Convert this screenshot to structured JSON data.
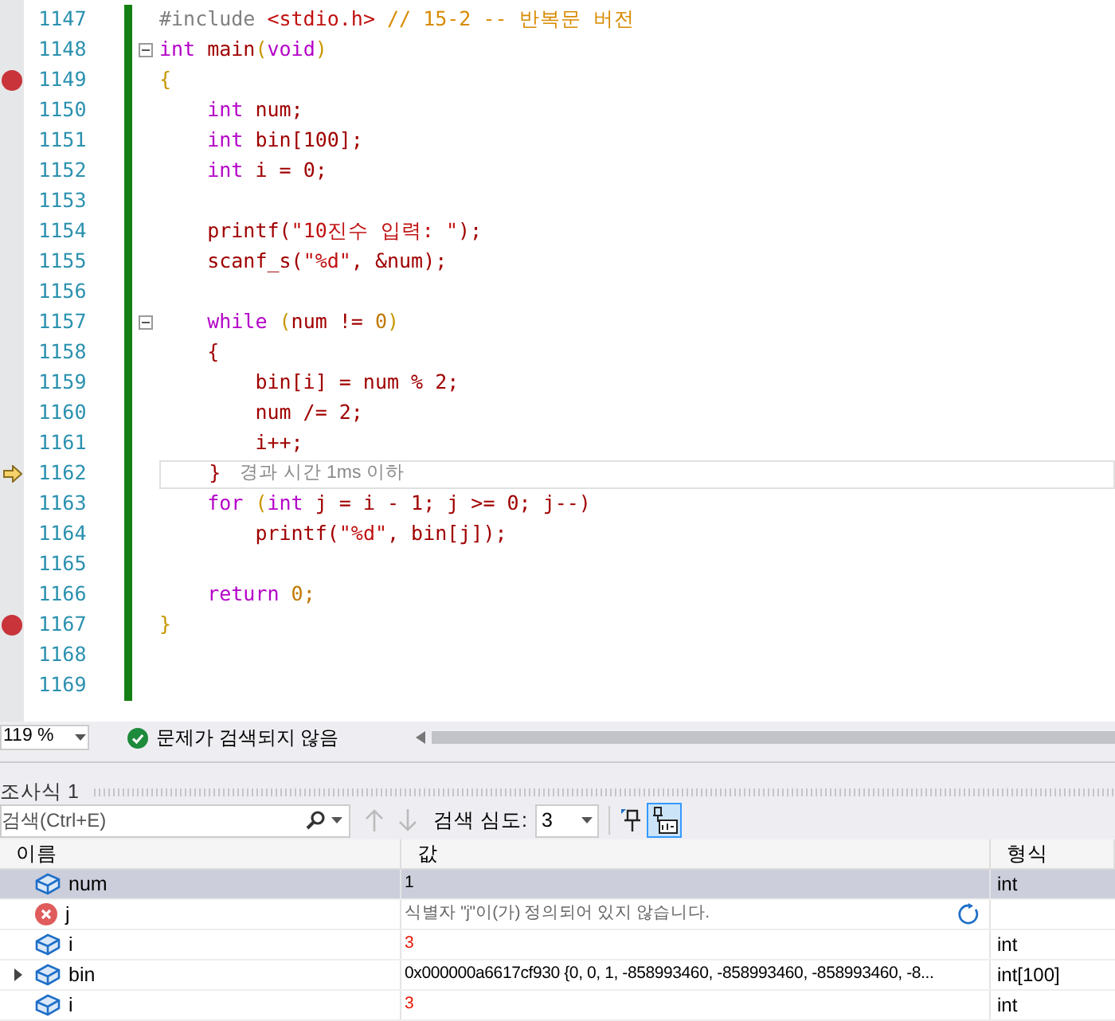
{
  "editor": {
    "lines": [
      {
        "number": "1147",
        "breakpoint": false,
        "current": false,
        "tokens": [
          {
            "kind": "pre",
            "text": "#include "
          },
          {
            "kind": "string",
            "text": "<stdio.h>"
          },
          {
            "kind": "comment",
            "text": " // 15-2 -- 반복문 버전"
          }
        ]
      },
      {
        "number": "1148",
        "breakpoint": false,
        "current": false,
        "fold": true,
        "tokens": [
          {
            "kind": "keyword",
            "text": "int"
          },
          {
            "kind": "ident",
            "text": " main"
          },
          {
            "kind": "punct",
            "text": "("
          },
          {
            "kind": "keyword",
            "text": "void"
          },
          {
            "kind": "punct",
            "text": ")"
          }
        ]
      },
      {
        "number": "1149",
        "breakpoint": true,
        "current": false,
        "tokens": [
          {
            "kind": "punct",
            "text": "{"
          }
        ]
      },
      {
        "number": "1150",
        "breakpoint": false,
        "current": false,
        "tokens": [
          {
            "kind": "keyword",
            "text": "    int"
          },
          {
            "kind": "ident",
            "text": " num;"
          }
        ]
      },
      {
        "number": "1151",
        "breakpoint": false,
        "current": false,
        "tokens": [
          {
            "kind": "keyword",
            "text": "    int"
          },
          {
            "kind": "ident",
            "text": " bin[100];"
          }
        ]
      },
      {
        "number": "1152",
        "breakpoint": false,
        "current": false,
        "tokens": [
          {
            "kind": "keyword",
            "text": "    int"
          },
          {
            "kind": "ident",
            "text": " i = 0;"
          }
        ]
      },
      {
        "number": "1153",
        "breakpoint": false,
        "current": false
      },
      {
        "number": "1154",
        "breakpoint": false,
        "current": false,
        "tokens": [
          {
            "kind": "ident",
            "text": "    printf("
          },
          {
            "kind": "string",
            "text": "\"10진수 입력: \""
          },
          {
            "kind": "ident",
            "text": ");"
          }
        ]
      },
      {
        "number": "1155",
        "breakpoint": false,
        "current": false,
        "tokens": [
          {
            "kind": "ident",
            "text": "    scanf_s("
          },
          {
            "kind": "string",
            "text": "\"%d\""
          },
          {
            "kind": "ident",
            "text": ", &num);"
          }
        ]
      },
      {
        "number": "1156",
        "breakpoint": false,
        "current": false
      },
      {
        "number": "1157",
        "breakpoint": false,
        "current": false,
        "fold": true,
        "tokens": [
          {
            "kind": "keyword",
            "text": "    while"
          },
          {
            "kind": "punct",
            "text": " ("
          },
          {
            "kind": "ident",
            "text": "num != "
          },
          {
            "kind": "number",
            "text": "0"
          },
          {
            "kind": "punct",
            "text": ")"
          }
        ]
      },
      {
        "number": "1158",
        "breakpoint": false,
        "current": false,
        "tokens": [
          {
            "kind": "ident",
            "text": "    {"
          }
        ]
      },
      {
        "number": "1159",
        "breakpoint": false,
        "current": false,
        "tokens": [
          {
            "kind": "ident",
            "text": "        bin[i] = num % 2;"
          }
        ]
      },
      {
        "number": "1160",
        "breakpoint": false,
        "current": false,
        "tokens": [
          {
            "kind": "ident",
            "text": "        num /= 2;"
          }
        ]
      },
      {
        "number": "1161",
        "breakpoint": false,
        "current": false,
        "tokens": [
          {
            "kind": "ident",
            "text": "        i++;"
          }
        ]
      },
      {
        "number": "1162",
        "breakpoint": false,
        "current": true,
        "hint": "경과 시간 1ms 이하",
        "tokens": [
          {
            "kind": "ident",
            "text": "    }"
          }
        ]
      },
      {
        "number": "1163",
        "breakpoint": false,
        "current": false,
        "tokens": [
          {
            "kind": "keyword",
            "text": "    for"
          },
          {
            "kind": "punct",
            "text": " ("
          },
          {
            "kind": "keyword",
            "text": "int"
          },
          {
            "kind": "ident",
            "text": " j = i - 1; j >= 0; j--)"
          }
        ]
      },
      {
        "number": "1164",
        "breakpoint": false,
        "current": false,
        "tokens": [
          {
            "kind": "ident",
            "text": "        printf("
          },
          {
            "kind": "string",
            "text": "\"%d\""
          },
          {
            "kind": "ident",
            "text": ", bin[j]);"
          }
        ]
      },
      {
        "number": "1165",
        "breakpoint": false,
        "current": false
      },
      {
        "number": "1166",
        "breakpoint": false,
        "current": false,
        "tokens": [
          {
            "kind": "keyword",
            "text": "    return"
          },
          {
            "kind": "number",
            "text": " 0;"
          }
        ]
      },
      {
        "number": "1167",
        "breakpoint": true,
        "current": false,
        "tokens": [
          {
            "kind": "punct",
            "text": "}"
          }
        ]
      },
      {
        "number": "1168",
        "breakpoint": false,
        "current": false
      },
      {
        "number": "1169",
        "breakpoint": false,
        "current": false
      }
    ]
  },
  "status_bar": {
    "zoom": "119 %",
    "issues": "문제가 검색되지 않음"
  },
  "watch": {
    "title": "조사식 1",
    "search": {
      "placeholder": "검색(Ctrl+E)"
    },
    "depth_label": "검색 심도:",
    "depth": "3",
    "columns": [
      "이름",
      "값",
      "형식"
    ],
    "rows": [
      {
        "kind": "variable",
        "name": "num",
        "value": "1",
        "type": "int",
        "selected": true,
        "changed": false
      },
      {
        "kind": "error",
        "name": "j",
        "value": "식별자 \"j\"이(가) 정의되어 있지 않습니다.",
        "selected": false
      },
      {
        "kind": "variable",
        "name": "i",
        "value": "3",
        "type": "int",
        "selected": false,
        "changed": true
      },
      {
        "kind": "variable",
        "name": "bin",
        "value": "0x000000a6617cf930 {0, 0, 1, -858993460, -858993460, -858993460, -8...",
        "type": "int[100]",
        "selected": false,
        "changed": false,
        "expanded": false
      },
      {
        "kind": "variable",
        "name": "i",
        "value": "3",
        "type": "int",
        "selected": false,
        "changed": true
      }
    ]
  }
}
